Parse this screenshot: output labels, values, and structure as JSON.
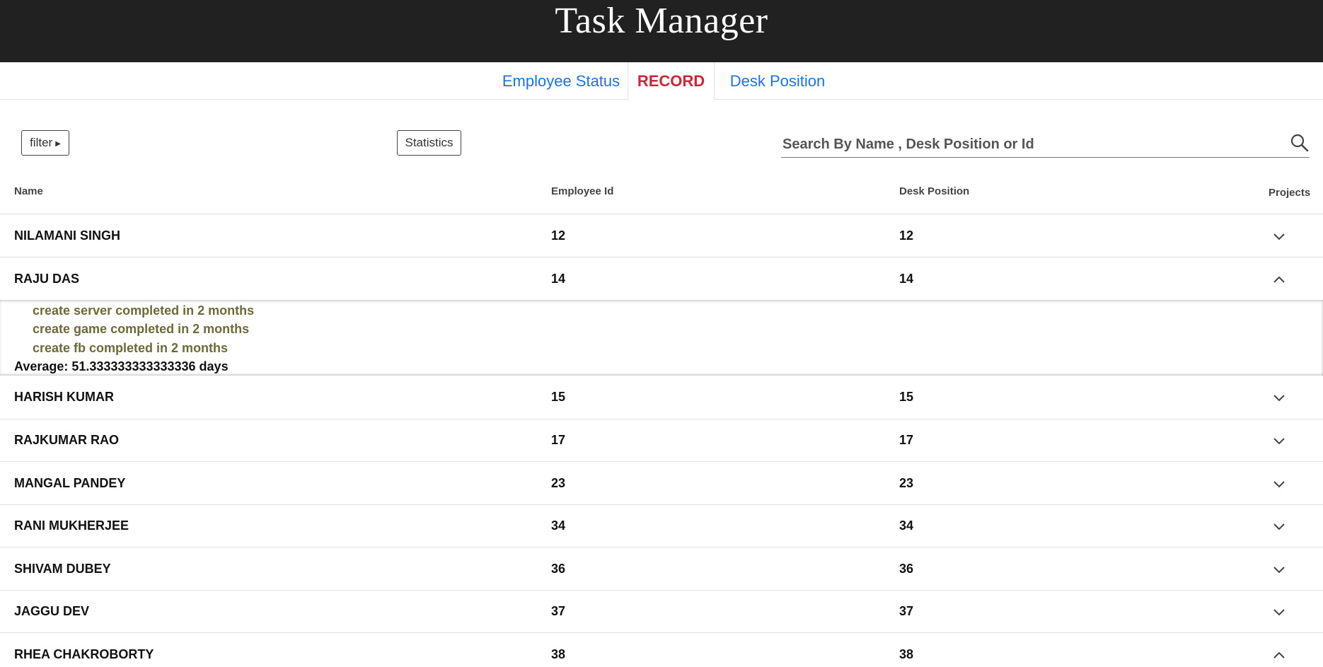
{
  "app": {
    "title": "Task Manager"
  },
  "tabs": [
    {
      "label": "Employee Status",
      "active": false
    },
    {
      "label": "RECORD",
      "active": true
    },
    {
      "label": "Desk Position",
      "active": false
    }
  ],
  "toolbar": {
    "filter_label": "filter",
    "statistics_label": "Statistics",
    "search_placeholder": "Search By Name , Desk Position or Id"
  },
  "table": {
    "columns": [
      "Name",
      "Employee Id",
      "Desk Position",
      "Projects"
    ],
    "rows": [
      {
        "name": "NILAMANI SINGH",
        "employee_id": "12",
        "desk_position": "12",
        "expanded": false
      },
      {
        "name": "RAJU DAS",
        "employee_id": "14",
        "desk_position": "14",
        "expanded": true
      },
      {
        "name": "HARISH KUMAR",
        "employee_id": "15",
        "desk_position": "15",
        "expanded": false
      },
      {
        "name": "RAJKUMAR RAO",
        "employee_id": "17",
        "desk_position": "17",
        "expanded": false
      },
      {
        "name": "MANGAL PANDEY",
        "employee_id": "23",
        "desk_position": "23",
        "expanded": false
      },
      {
        "name": "RANI MUKHERJEE",
        "employee_id": "34",
        "desk_position": "34",
        "expanded": false
      },
      {
        "name": "SHIVAM DUBEY",
        "employee_id": "36",
        "desk_position": "36",
        "expanded": false
      },
      {
        "name": "JAGGU DEV",
        "employee_id": "37",
        "desk_position": "37",
        "expanded": false
      },
      {
        "name": "RHEA CHAKROBORTY",
        "employee_id": "38",
        "desk_position": "38",
        "expanded": true
      }
    ],
    "expanded_detail": {
      "projects": [
        "create server completed in 2 months",
        "create game completed in 2 months",
        "create fb completed in 2 months"
      ],
      "average": "Average: 51.333333333333336 days"
    }
  },
  "colors": {
    "header_bg": "#212121",
    "tab_link": "#1a73e8",
    "tab_active": "#d0243a",
    "project_text": "#6b6b3a"
  }
}
